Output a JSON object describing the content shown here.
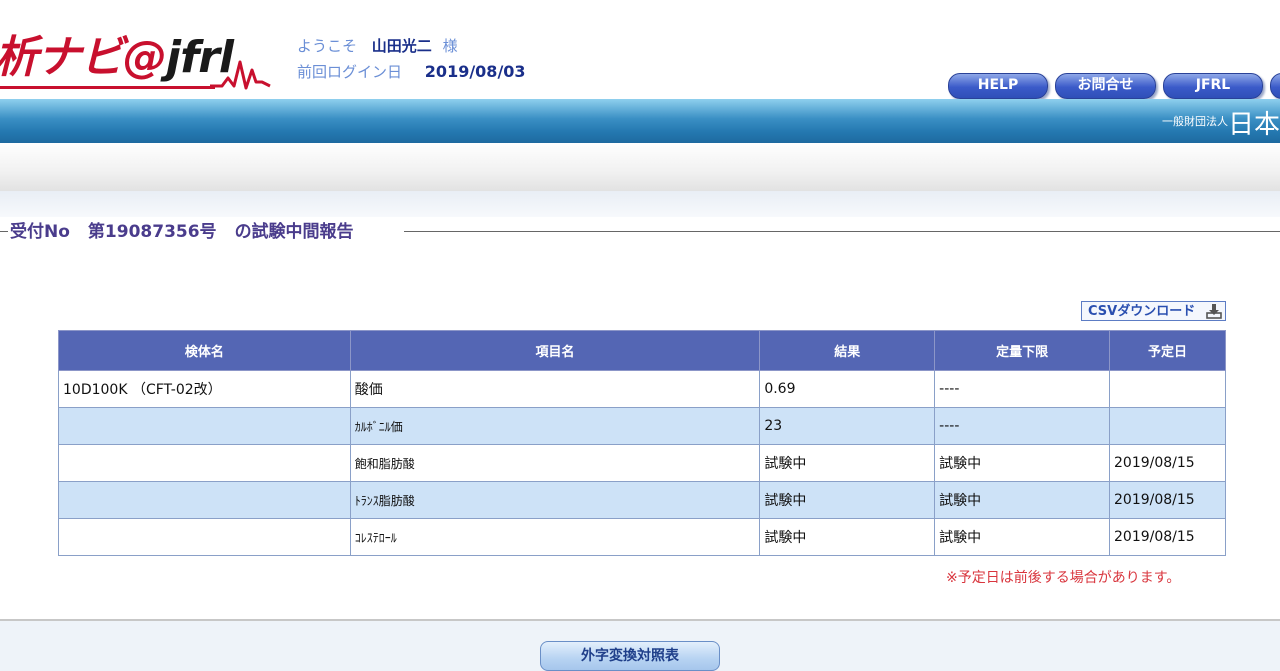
{
  "header": {
    "logo_main": "析ナビ@",
    "logo_jfrl": "jfrl",
    "welcome_label": "ようこそ",
    "user_name": "山田光二",
    "honorific": "様",
    "last_login_label": "前回ログイン日",
    "last_login_date": "2019/08/03",
    "nav_buttons": [
      "HELP",
      "お問合せ",
      "JFRL"
    ],
    "org_prefix": "一般財団法人",
    "org_name": "日本"
  },
  "section": {
    "receipt_label": "受付No",
    "receipt_number": "第19087356号",
    "title_suffix": "の試験中間報告"
  },
  "csv_button": {
    "label": "CSVダウンロード",
    "icon": "download-icon"
  },
  "table": {
    "headers": [
      "検体名",
      "項目名",
      "結果",
      "定量下限",
      "予定日"
    ],
    "rows": [
      {
        "sample": "10D100K （CFT-02改）",
        "item": "酸価",
        "result": "0.69",
        "lower_limit": "----",
        "due_date": ""
      },
      {
        "sample": "",
        "item": "ｶﾙﾎﾞﾆﾙ価",
        "result": "23",
        "lower_limit": "----",
        "due_date": ""
      },
      {
        "sample": "",
        "item": "飽和脂肪酸",
        "result": "試験中",
        "lower_limit": "試験中",
        "due_date": "2019/08/15"
      },
      {
        "sample": "",
        "item": "ﾄﾗﾝｽ脂肪酸",
        "result": "試験中",
        "lower_limit": "試験中",
        "due_date": "2019/08/15"
      },
      {
        "sample": "",
        "item": "ｺﾚｽﾃﾛｰﾙ",
        "result": "試験中",
        "lower_limit": "試験中",
        "due_date": "2019/08/15"
      }
    ]
  },
  "note": "※予定日は前後する場合があります。",
  "footer": {
    "gaiji_button": "外字変換対照表"
  },
  "colors": {
    "logo_red": "#c8102e",
    "header_blue": "#2478b0",
    "table_header": "#5466b4",
    "row_alt": "#cde2f7",
    "note_red": "#d9363e"
  }
}
